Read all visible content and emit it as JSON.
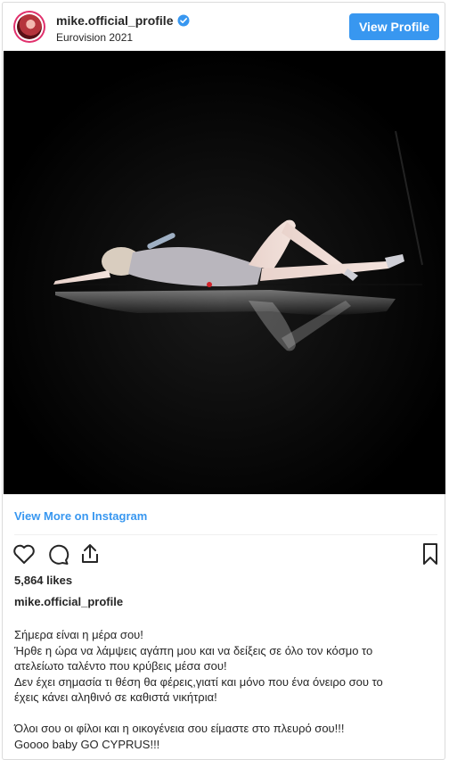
{
  "header": {
    "username": "mike.official_profile",
    "subtitle": "Eurovision 2021",
    "view_profile_label": "View Profile",
    "verified_color": "#3897f0"
  },
  "view_more_label": "View More on Instagram",
  "actions": {
    "like_icon": "heart-outline-icon",
    "comment_icon": "comment-bubble-icon",
    "share_icon": "share-upload-icon",
    "save_icon": "bookmark-outline-icon"
  },
  "likes": "5,864 likes",
  "caption": {
    "username": "mike.official_profile",
    "lines": [
      "Σήμερα είναι η μέρα σου!",
      "Ήρθε η ώρα να λάμψεις αγάπη μου και να δείξεις σε όλο τον κόσμο το",
      "ατελείωτο ταλέντο που κρύβεις μέσα σου!",
      "Δεν έχει σημασία τι θέση θα φέρεις,γιατί και μόνο που ένα όνειρο σου το",
      "έχεις κάνει αληθινό σε καθιστά νικήτρια!",
      "",
      "Όλοι σου οι φίλοι και η οικογένεια σου είμαστε στο πλευρό σου!!!",
      "Goooo baby GO CYPRUS!!!"
    ]
  },
  "colors": {
    "accent": "#3897f0",
    "text": "#262626",
    "border": "#dbdbdb"
  }
}
